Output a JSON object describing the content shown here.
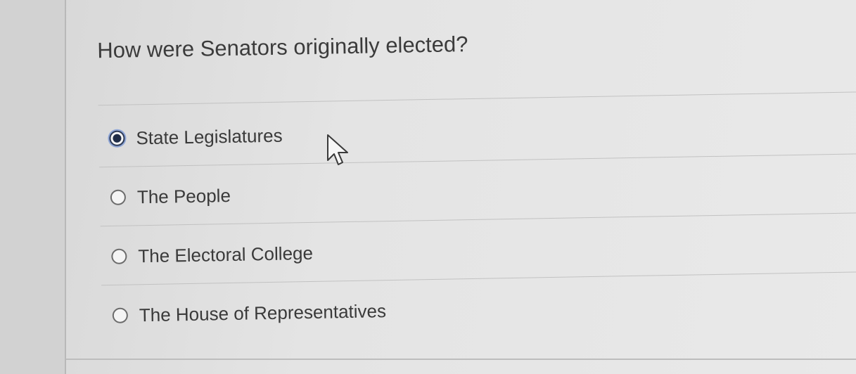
{
  "question": {
    "text": "How were Senators originally elected?"
  },
  "answers": [
    {
      "label": "State Legislatures",
      "selected": true
    },
    {
      "label": "The People",
      "selected": false
    },
    {
      "label": "The Electoral College",
      "selected": false
    },
    {
      "label": "The House of Representatives",
      "selected": false
    }
  ],
  "cursor": {
    "icon": "arrow-pointer-icon"
  },
  "colors": {
    "selected_radio": "#1f2c46",
    "text": "#3a3a3a"
  }
}
